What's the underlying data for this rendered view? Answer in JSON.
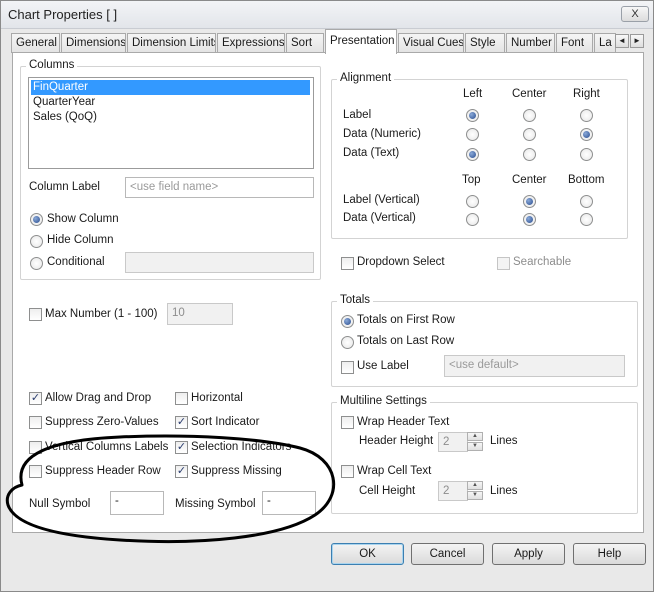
{
  "window": {
    "title": "Chart Properties [ ]",
    "close_label": "X"
  },
  "tabs": [
    "General",
    "Dimensions",
    "Dimension Limits",
    "Expressions",
    "Sort",
    "Presentation",
    "Visual Cues",
    "Style",
    "Number",
    "Font",
    "La"
  ],
  "active_tab": "Presentation",
  "tab_scroll": {
    "left": "◄",
    "right": "►"
  },
  "columns": {
    "group_label": "Columns",
    "items": [
      "FinQuarter",
      "QuarterYear",
      "Sales (QoQ)"
    ],
    "selected": "FinQuarter",
    "column_label": "Column Label",
    "column_label_placeholder": "<use field name>",
    "show_column": "Show Column",
    "hide_column": "Hide Column",
    "conditional": "Conditional",
    "visibility_selected": "Show Column"
  },
  "alignment": {
    "group_label": "Alignment",
    "h_headers": [
      "Left",
      "Center",
      "Right"
    ],
    "h_rows": [
      {
        "label": "Label",
        "selected": "Left"
      },
      {
        "label": "Data (Numeric)",
        "selected": "Right"
      },
      {
        "label": "Data (Text)",
        "selected": "Left"
      }
    ],
    "v_headers": [
      "Top",
      "Center",
      "Bottom"
    ],
    "v_rows": [
      {
        "label": "Label (Vertical)",
        "selected": "Center"
      },
      {
        "label": "Data (Vertical)",
        "selected": "Center"
      }
    ]
  },
  "dropdown_select": {
    "label": "Dropdown Select",
    "checked": false
  },
  "searchable": {
    "label": "Searchable",
    "checked": false,
    "disabled": true
  },
  "max_number": {
    "label": "Max Number (1 - 100)",
    "value": "10",
    "checked": false
  },
  "totals": {
    "group_label": "Totals",
    "first_row": "Totals on First Row",
    "last_row": "Totals on Last Row",
    "selected": "Totals on First Row",
    "use_label": "Use Label",
    "use_label_checked": false,
    "placeholder": "<use default>"
  },
  "options": {
    "allow_drag_drop": {
      "label": "Allow Drag and Drop",
      "checked": true
    },
    "horizontal": {
      "label": "Horizontal",
      "checked": false
    },
    "suppress_zero": {
      "label": "Suppress Zero-Values",
      "checked": false
    },
    "sort_indicator": {
      "label": "Sort Indicator",
      "checked": true
    },
    "vertical_col_labels": {
      "label": "Vertical Columns Labels",
      "checked": false
    },
    "selection_indicators": {
      "label": "Selection Indicators",
      "checked": true
    },
    "suppress_header_row": {
      "label": "Suppress Header Row",
      "checked": false
    },
    "suppress_missing": {
      "label": "Suppress Missing",
      "checked": true
    }
  },
  "null_symbol": {
    "label": "Null Symbol",
    "value": "-"
  },
  "missing_symbol": {
    "label": "Missing Symbol",
    "value": "-"
  },
  "multiline": {
    "group_label": "Multiline Settings",
    "wrap_header": {
      "label": "Wrap Header Text",
      "checked": false
    },
    "header_height": {
      "label": "Header Height",
      "value": "2",
      "unit": "Lines"
    },
    "wrap_cell": {
      "label": "Wrap Cell Text",
      "checked": false
    },
    "cell_height": {
      "label": "Cell Height",
      "value": "2",
      "unit": "Lines"
    }
  },
  "buttons": {
    "ok": "OK",
    "cancel": "Cancel",
    "apply": "Apply",
    "help": "Help"
  },
  "colors": {
    "selection": "#3399ff",
    "annotation_ink": "#000000"
  }
}
